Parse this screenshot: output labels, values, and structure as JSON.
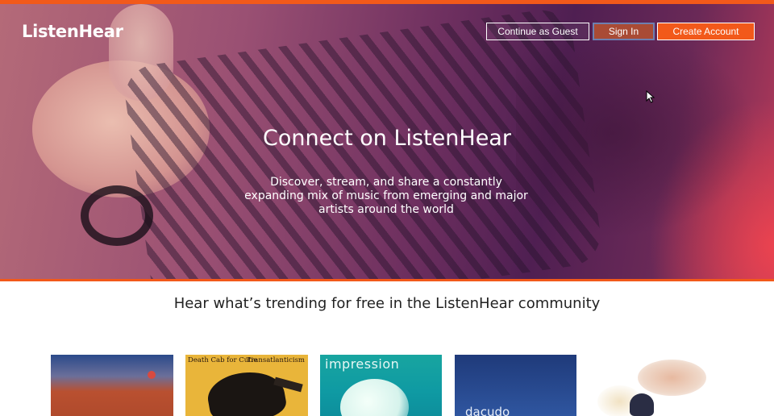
{
  "app": {
    "logo": "ListenHear"
  },
  "header": {
    "buttons": {
      "guest": "Continue as Guest",
      "sign_in": "Sign In",
      "create_account": "Create Account"
    }
  },
  "hero": {
    "title": "Connect on ListenHear",
    "subtitle": "Discover, stream, and share a constantly expanding mix of music from emerging and major artists around the world"
  },
  "trending": {
    "heading": "Hear what’s trending for free in the ListenHear community",
    "albums": [
      {
        "cover_texts": []
      },
      {
        "cover_texts": [
          "Death Cab for Cutie",
          "Transatlanticism"
        ]
      },
      {
        "cover_texts": [
          "impression"
        ]
      },
      {
        "cover_texts": [
          "dacudo"
        ]
      },
      {
        "cover_texts": []
      }
    ]
  },
  "colors": {
    "accent_orange": "#f2591a",
    "sign_in_bg": "#a94b35",
    "sign_in_border": "#6d7fb0",
    "hero_purple": "#6d2f5f"
  },
  "icons": {
    "cursor": "mouse-pointer-icon"
  }
}
